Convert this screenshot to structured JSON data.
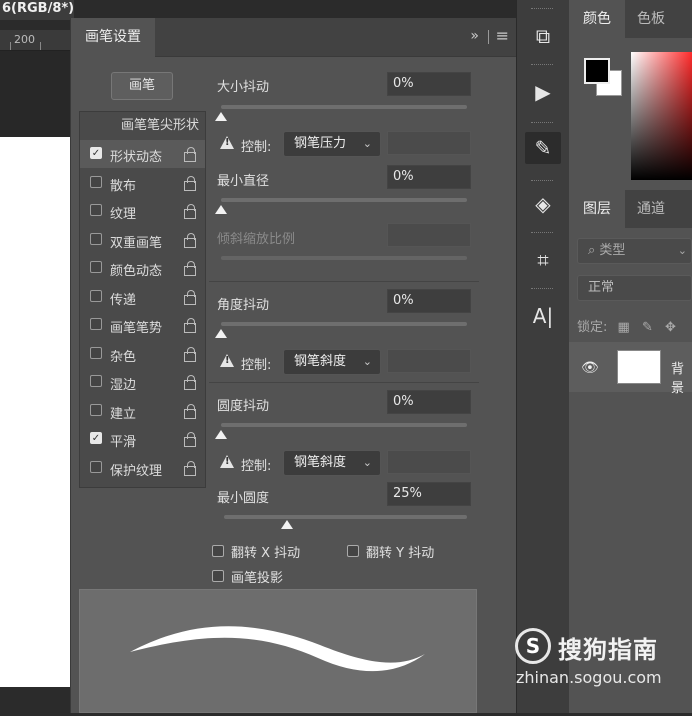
{
  "document": {
    "title": "6(RGB/8*)",
    "ruler_tick": "200"
  },
  "brush_panel": {
    "tab": "画笔设置",
    "collapse_glyph": "»",
    "menu_glyph": "≡",
    "brush_button": "画笔",
    "tip_shape_label": "画笔笔尖形状",
    "options": [
      {
        "label": "形状动态",
        "checked": true
      },
      {
        "label": "散布",
        "checked": false
      },
      {
        "label": "纹理",
        "checked": false
      },
      {
        "label": "双重画笔",
        "checked": false
      },
      {
        "label": "颜色动态",
        "checked": false
      },
      {
        "label": "传递",
        "checked": false
      },
      {
        "label": "画笔笔势",
        "checked": false
      },
      {
        "label": "杂色",
        "checked": false
      },
      {
        "label": "湿边",
        "checked": false
      },
      {
        "label": "建立",
        "checked": false
      },
      {
        "label": "平滑",
        "checked": true
      },
      {
        "label": "保护纹理",
        "checked": false
      }
    ],
    "size_jitter": {
      "label": "大小抖动",
      "value": "0%",
      "level": 0
    },
    "control1": {
      "label": "控制:",
      "value": "钢笔压力"
    },
    "min_diameter": {
      "label": "最小直径",
      "value": "0%",
      "level": 0
    },
    "tilt_scale": {
      "label": "倾斜缩放比例"
    },
    "angle_jitter": {
      "label": "角度抖动",
      "value": "0%",
      "level": 0
    },
    "control2": {
      "label": "控制:",
      "value": "钢笔斜度"
    },
    "roundness_jitter": {
      "label": "圆度抖动",
      "value": "0%",
      "level": 0
    },
    "control3": {
      "label": "控制:",
      "value": "钢笔斜度"
    },
    "min_roundness": {
      "label": "最小圆度",
      "value": "25%",
      "level": 25
    },
    "flip_x": "翻转 X 抖动",
    "flip_y": "翻转 Y 抖动",
    "brush_projection": "画笔投影"
  },
  "right_panels": {
    "color_tabs": [
      "颜色",
      "色板"
    ],
    "layer_tabs": [
      "图层",
      "通道"
    ],
    "search_type": "类型",
    "blend_mode": "正常",
    "lock_label": "锁定:",
    "layer_name": "背景"
  },
  "watermark": {
    "brand": "搜狗指南",
    "url": "zhinan.sogou.com"
  },
  "colors": {
    "panel": "#535353",
    "accent_white": "#f2f2f2",
    "foreground": "#000000",
    "background": "#ffffff"
  }
}
